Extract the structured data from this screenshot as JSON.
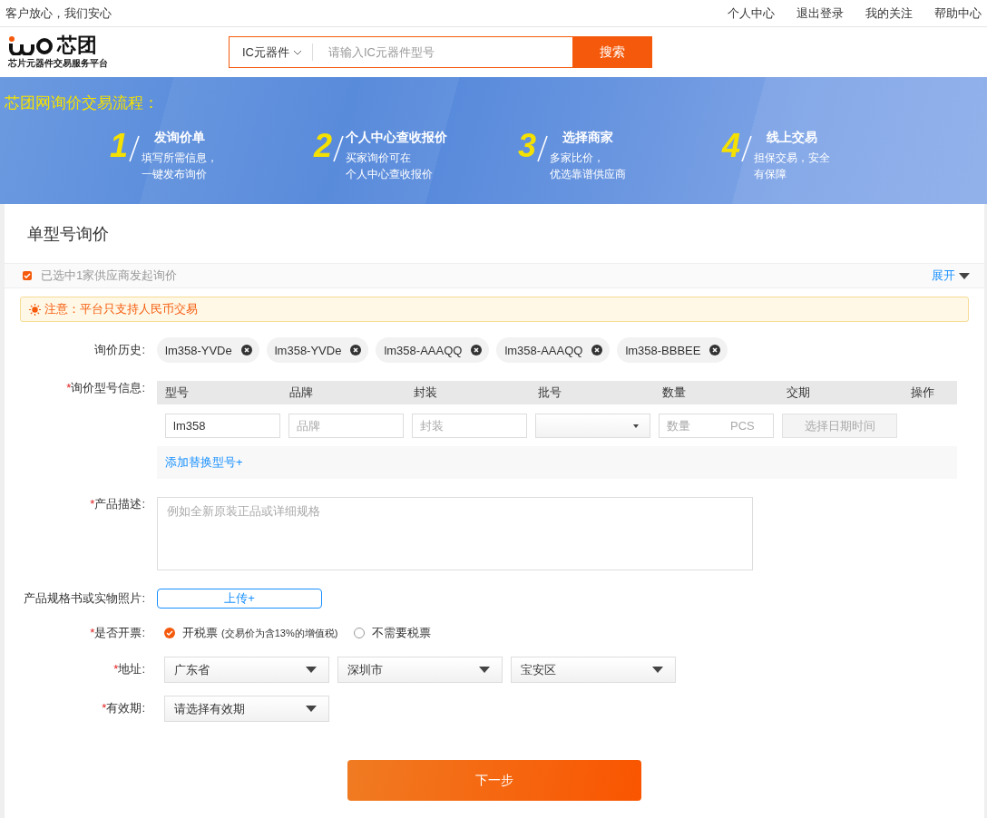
{
  "top_bar": {
    "slogan": "客户放心，我们安心",
    "links": [
      "个人中心",
      "退出登录",
      "我的关注",
      "帮助中心"
    ]
  },
  "header": {
    "logo": {
      "text": "芯团",
      "subtitle": "芯片元器件交易服务平台"
    },
    "search": {
      "category": "IC元器件",
      "placeholder": "请输入IC元器件型号",
      "button": "搜索"
    }
  },
  "banner": {
    "title": "芯团网询价交易流程：",
    "steps": [
      {
        "number": "1",
        "title": "发询价单",
        "lines": [
          "填写所需信息，",
          "一键发布询价"
        ]
      },
      {
        "number": "2",
        "title": "个人中心查收报价",
        "lines": [
          "买家询价可在",
          "个人中心查收报价"
        ]
      },
      {
        "number": "3",
        "title": "选择商家",
        "lines": [
          "多家比价，",
          "优选靠谱供应商"
        ]
      },
      {
        "number": "4",
        "title": "线上交易",
        "lines": [
          "担保交易，安全",
          "有保障"
        ]
      }
    ]
  },
  "inquiry": {
    "title": "单型号询价",
    "supplier_bar": {
      "checked": true,
      "text": "已选中1家供应商发起询价",
      "expand": "展开"
    },
    "notice": "注意：平台只支持人民币交易",
    "history": {
      "label": "询价历史:",
      "tags": [
        "lm358-YVDe",
        "lm358-YVDe",
        "lm358-AAAQQ",
        "lm358-AAAQQ",
        "lm358-BBBEE"
      ]
    },
    "models": {
      "required_mark": "*",
      "label": "询价型号信息:",
      "columns": [
        "型号",
        "品牌",
        "封装",
        "批号",
        "数量",
        "交期",
        "操作"
      ],
      "row": {
        "model": "lm358",
        "brand_placeholder": "品牌",
        "package_placeholder": "封装",
        "quantity_placeholder": "数量",
        "unit": "PCS",
        "delivery": "选择日期时间"
      },
      "add_link": "添加替换型号+"
    },
    "description": {
      "required_mark": "*",
      "label": "产品描述:",
      "placeholder": "例如全新原装正品或详细规格"
    },
    "upload": {
      "label": "产品规格书或实物照片:",
      "button": "上传+"
    },
    "invoice": {
      "required_mark": "*",
      "label": "是否开票:",
      "options": [
        {
          "label": "开税票",
          "note": "(交易价为含13%的增值税)",
          "selected": true
        },
        {
          "label": "不需要税票",
          "selected": false
        }
      ]
    },
    "address": {
      "required_mark": "*",
      "label": "地址:",
      "selects": [
        "广东省",
        "深圳市",
        "宝安区"
      ]
    },
    "validity": {
      "required_mark": "*",
      "label": "有效期:",
      "value": "请选择有效期"
    },
    "next_button": "下一步"
  }
}
